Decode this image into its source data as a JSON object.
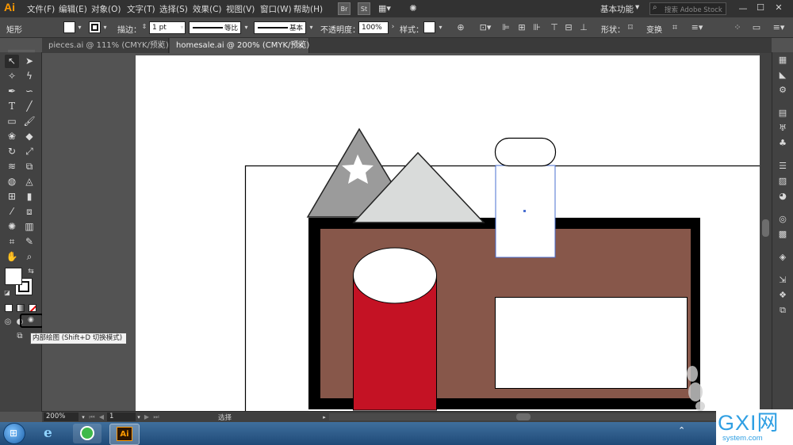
{
  "app": {
    "logo": "Ai"
  },
  "menubar": {
    "items": [
      "文件(F)",
      "编辑(E)",
      "对象(O)",
      "文字(T)",
      "选择(S)",
      "效果(C)",
      "视图(V)",
      "窗口(W)",
      "帮助(H)"
    ],
    "bridge": "Br",
    "stock": "St",
    "workspace": "基本功能",
    "search_placeholder": "搜索 Adobe Stock"
  },
  "controlbar": {
    "selection_label": "矩形",
    "stroke_label": "描边：",
    "stroke_value": "1 pt",
    "profile_label": "等比",
    "brush_label": "基本",
    "opacity_label": "不透明度：",
    "opacity_value": "100%",
    "style_label": "样式：",
    "shape_label": "形状：",
    "transform_label": "变换"
  },
  "tabs": [
    {
      "label": "pieces.ai @ 111% (CMYK/预览)",
      "active": false
    },
    {
      "label": "homesale.ai @ 200% (CMYK/预览)",
      "active": true
    }
  ],
  "statusbar": {
    "zoom": "200%",
    "page": "1",
    "tool": "选择"
  },
  "tooltip": "内部绘图 (Shift+D 切换模式)",
  "colors": {
    "wall": "#87574a",
    "door": "#c41224",
    "roof_dark": "#9b9b9b",
    "roof_light": "#d9dbda",
    "border": "#000000",
    "accent": "#ff9a00"
  },
  "watermark": {
    "brand": "GXI网",
    "domain": "system.com"
  },
  "taskbar": {
    "ai_label": "Ai"
  }
}
